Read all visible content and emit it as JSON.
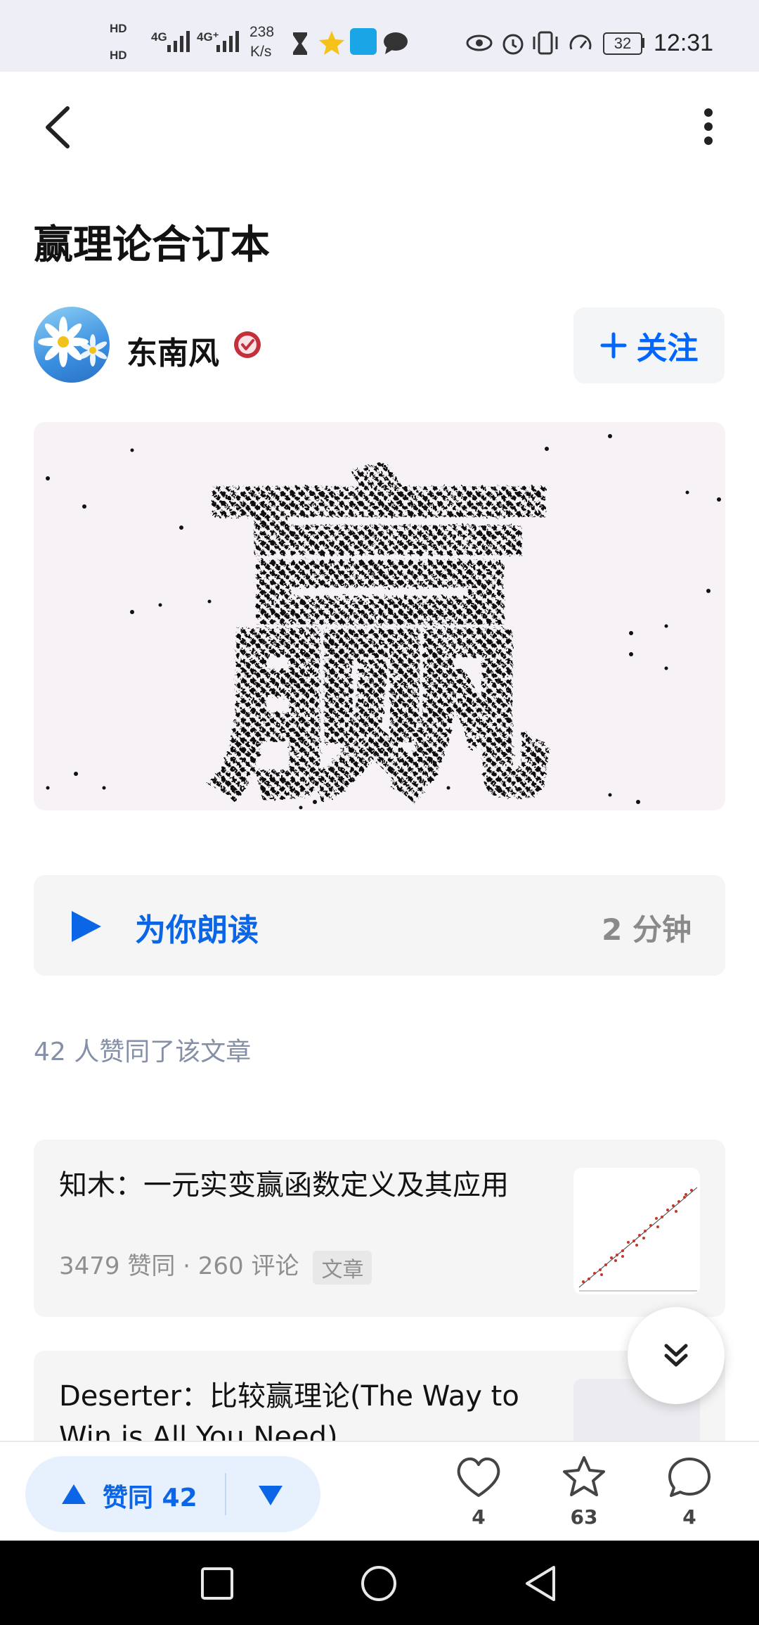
{
  "status_bar": {
    "hd1": "HD",
    "hd2": "HD",
    "net1": "4G",
    "net2": "4G⁺",
    "speed_value": "238",
    "speed_unit": "K/s",
    "battery": "32",
    "time": "12:31"
  },
  "header": {
    "back_icon": "chevron-left-icon",
    "more_icon": "more-vertical-icon"
  },
  "article": {
    "title": "赢理论合订本",
    "author": "东南风",
    "follow_label": "关注",
    "cover_text": "赢"
  },
  "listen": {
    "label": "为你朗读",
    "duration": "2 分钟"
  },
  "likes_note": "42 人赞同了该文章",
  "related": [
    {
      "title": "知木：一元实变赢函数定义及其应用",
      "meta": "3479 赞同 · 260 评论",
      "tag": "文章"
    },
    {
      "title": "Deserter：比较赢理论(The Way to Win is All You Need)"
    }
  ],
  "bottom_bar": {
    "vote_label": "赞同 42",
    "like_count": "4",
    "favorite_count": "63",
    "comment_count": "4"
  },
  "colors": {
    "accent": "#0a66e6",
    "muted": "#8590a6"
  }
}
